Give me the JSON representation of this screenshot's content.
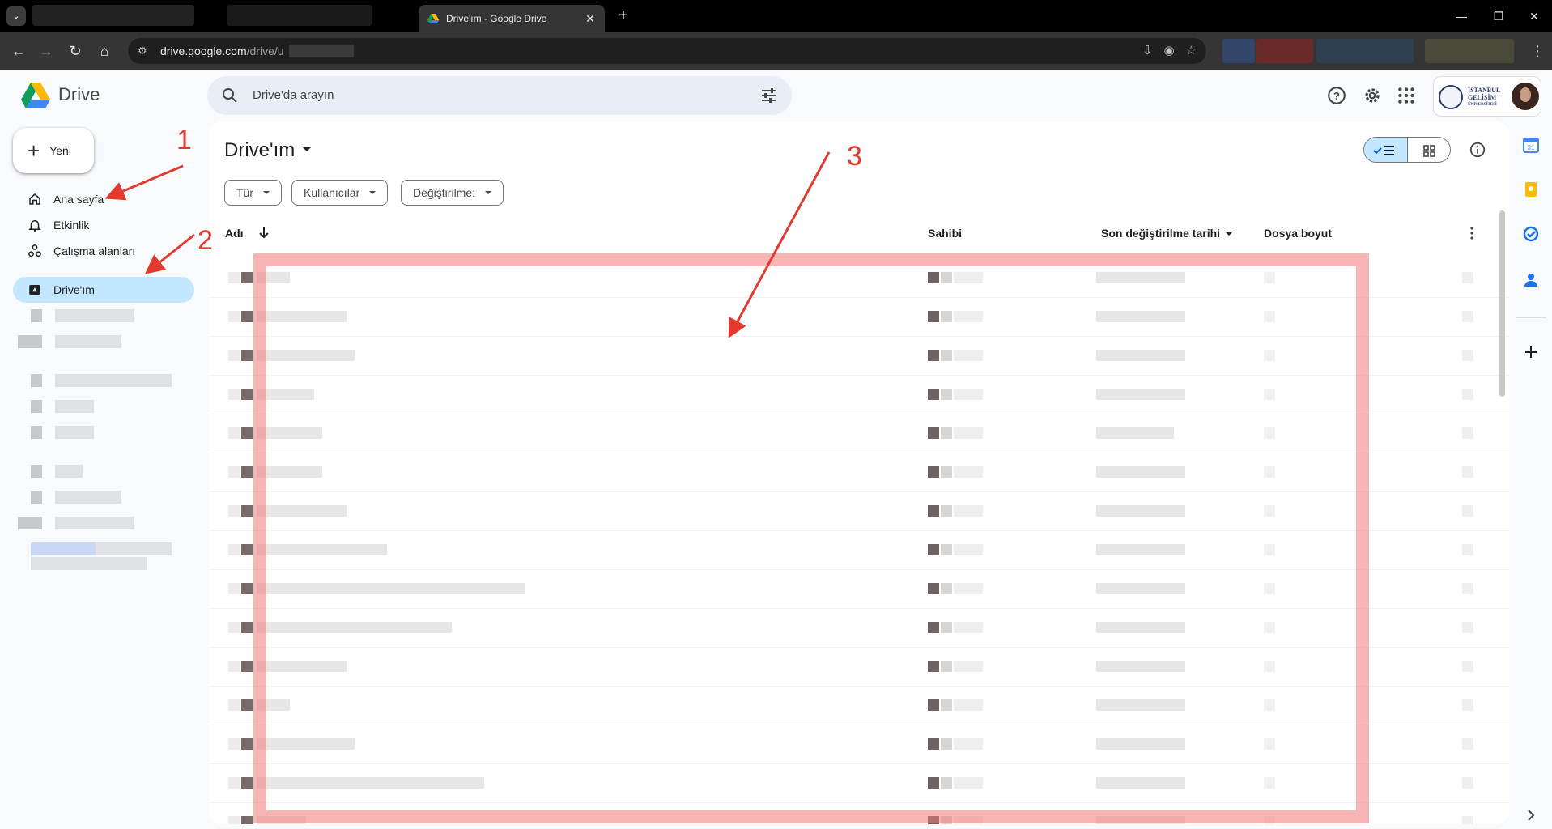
{
  "browser": {
    "tab_title": "Drive'ım - Google Drive",
    "url_main": "drive.google.com",
    "url_path": "/drive/u"
  },
  "header": {
    "app_name": "Drive",
    "search_placeholder": "Drive'da arayın",
    "account_org_line1": "İSTANBUL",
    "account_org_line2": "GELİŞİM",
    "account_org_line3": "ÜNİVERSİTESİ"
  },
  "sidebar": {
    "new_label": "Yeni",
    "items": [
      {
        "label": "Ana sayfa",
        "icon": "home-icon"
      },
      {
        "label": "Etkinlik",
        "icon": "bell-icon"
      },
      {
        "label": "Çalışma alanları",
        "icon": "workspaces-icon"
      },
      {
        "label": "Drive'ım",
        "icon": "my-drive-icon"
      }
    ]
  },
  "main": {
    "title": "Drive'ım",
    "filters": [
      "Tür",
      "Kullanıcılar",
      "Değiştirilme:"
    ],
    "columns": {
      "name": "Adı",
      "owner": "Sahibi",
      "modified": "Son değiştirilme tarihi",
      "size": "Dosya boyut"
    },
    "row_count": 15
  },
  "annotations": {
    "labels": [
      "1",
      "2",
      "3"
    ],
    "color": "#e23a2e"
  },
  "colors": {
    "accent": "#c2e7ff",
    "surface": "#f8fafd",
    "search_bg": "#e9eef6"
  }
}
